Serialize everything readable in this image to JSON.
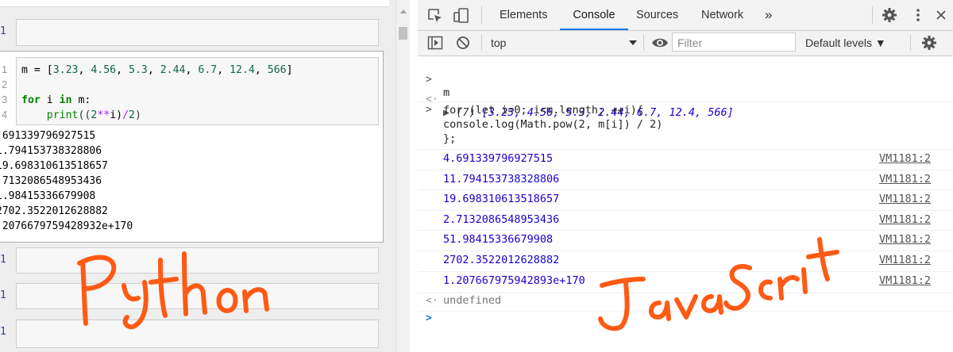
{
  "notebook": {
    "line_label": "1",
    "code_lines": [
      {
        "n": "1",
        "segments": [
          {
            "t": "m = [",
            "c": ""
          },
          {
            "t": "3.23",
            "c": "num-c"
          },
          {
            "t": ", ",
            "c": ""
          },
          {
            "t": "4.56",
            "c": "num-c"
          },
          {
            "t": ", ",
            "c": ""
          },
          {
            "t": "5.3",
            "c": "num-c"
          },
          {
            "t": ", ",
            "c": ""
          },
          {
            "t": "2.44",
            "c": "num-c"
          },
          {
            "t": ", ",
            "c": ""
          },
          {
            "t": "6.7",
            "c": "num-c"
          },
          {
            "t": ", ",
            "c": ""
          },
          {
            "t": "12.4",
            "c": "num-c"
          },
          {
            "t": ", ",
            "c": ""
          },
          {
            "t": "566",
            "c": "num-c"
          },
          {
            "t": "]",
            "c": ""
          }
        ]
      },
      {
        "n": "2",
        "segments": []
      },
      {
        "n": "3",
        "segments": [
          {
            "t": "for",
            "c": "kw"
          },
          {
            "t": " i ",
            "c": ""
          },
          {
            "t": "in",
            "c": "kw"
          },
          {
            "t": " m:",
            "c": ""
          }
        ]
      },
      {
        "n": "4",
        "segments": [
          {
            "t": "    ",
            "c": ""
          },
          {
            "t": "print",
            "c": "bi"
          },
          {
            "t": "((",
            "c": "paren"
          },
          {
            "t": "2",
            "c": "num-c"
          },
          {
            "t": "**",
            "c": "op"
          },
          {
            "t": "i)",
            "c": ""
          },
          {
            "t": "/",
            "c": "op"
          },
          {
            "t": "2",
            "c": "num-c"
          },
          {
            "t": ")",
            "c": "paren"
          }
        ]
      }
    ],
    "outputs": [
      ".691339796927515",
      "1.794153738328806",
      "19.698310613518657",
      ".7132086548953436",
      "1.98415336679908",
      "2702.3522012628882",
      ".2076679759428932e+170"
    ],
    "handwriting": "Python"
  },
  "devtools": {
    "tabs": [
      "Elements",
      "Console",
      "Sources",
      "Network"
    ],
    "active_tab": "Console",
    "more_tabs": "»",
    "context": "top",
    "filter_placeholder": "Filter",
    "levels": "Default levels ▼",
    "console": {
      "input1": "m",
      "result1_count": "(7)",
      "result1_values": "[3.23, 4.56, 5.3, 2.44, 6.7, 12.4, 566]",
      "input2_lines": [
        "for (let i=0; i<m.length; ++i){",
        "console.log(Math.pow(2, m[i]) / 2)",
        "};"
      ],
      "logs": [
        {
          "value": "4.691339796927515",
          "source": "VM1181:2"
        },
        {
          "value": "11.794153738328806",
          "source": "VM1181:2"
        },
        {
          "value": "19.698310613518657",
          "source": "VM1181:2"
        },
        {
          "value": "2.7132086548953436",
          "source": "VM1181:2"
        },
        {
          "value": "51.98415336679908",
          "source": "VM1181:2"
        },
        {
          "value": "2702.3522012628882",
          "source": "VM1181:2"
        },
        {
          "value": "1.207667975942893e+170",
          "source": "VM1181:2"
        }
      ],
      "final_result": "undefined"
    },
    "handwriting": "JavaScrit"
  }
}
